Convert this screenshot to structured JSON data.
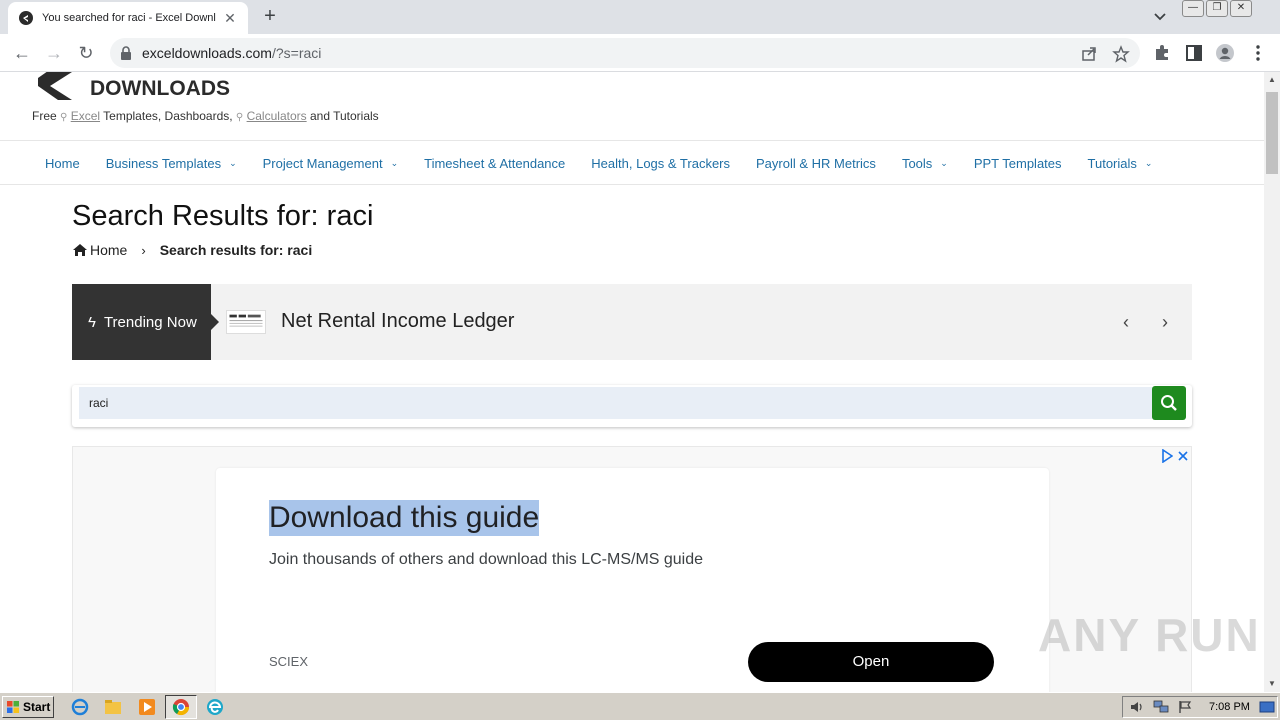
{
  "browser": {
    "tab": {
      "title": "You searched for raci - Excel Downloads",
      "close_glyph": "✕"
    },
    "new_tab_glyph": "+",
    "nav": {
      "back_glyph": "←",
      "forward_glyph": "→",
      "reload_glyph": "↻"
    },
    "url": {
      "host": "exceldownloads.com",
      "path": "/?s=raci"
    },
    "window_controls": [
      "—",
      "❐",
      "✕"
    ]
  },
  "site": {
    "logo_text": "EXCEL DOWNLOADS",
    "tagline": {
      "prefix": "Free",
      "link1": "Excel",
      "middle": "Templates, Dashboards,",
      "link2": "Calculators",
      "suffix": "and Tutorials"
    },
    "nav": [
      {
        "label": "Home",
        "dropdown": false
      },
      {
        "label": "Business Templates",
        "dropdown": true
      },
      {
        "label": "Project Management",
        "dropdown": true
      },
      {
        "label": "Timesheet & Attendance",
        "dropdown": false
      },
      {
        "label": "Health, Logs & Trackers",
        "dropdown": false
      },
      {
        "label": "Payroll & HR Metrics",
        "dropdown": false
      },
      {
        "label": "Tools",
        "dropdown": true
      },
      {
        "label": "PPT Templates",
        "dropdown": false
      },
      {
        "label": "Tutorials",
        "dropdown": true
      }
    ],
    "brand_color": "#1f6fa5",
    "search_button_color": "#1e8a1e"
  },
  "page": {
    "title": "Search Results for: raci",
    "breadcrumb": {
      "home": "Home",
      "separator": "›",
      "current": "Search results for: raci"
    },
    "trending": {
      "label": "Trending Now",
      "item": "Net Rental Income Ledger"
    },
    "search": {
      "value": "raci"
    }
  },
  "ad": {
    "title": "Download this guide",
    "subtitle": "Join thousands of others and download this LC-MS/MS guide",
    "brand": "SCIEX",
    "cta": "Open"
  },
  "watermark": "ANY RUN",
  "taskbar": {
    "start": "Start",
    "clock": "7:08 PM"
  }
}
